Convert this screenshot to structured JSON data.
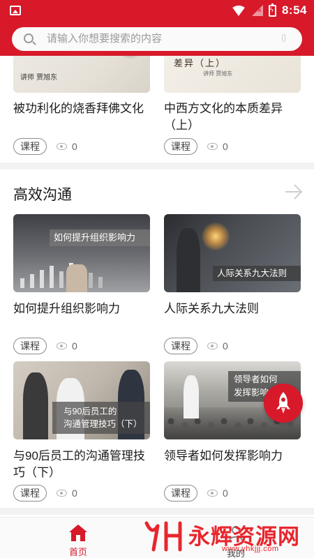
{
  "status_bar": {
    "time": "8:54",
    "icons": [
      "image-icon",
      "wifi-icon",
      "signal-off-icon",
      "battery-charging-icon"
    ]
  },
  "search": {
    "placeholder": "请输入你想要搜索的内容",
    "value": ""
  },
  "colors": {
    "brand_red": "#d7192a",
    "watermark_red": "#e8262d"
  },
  "top_courses": [
    {
      "title": "被功利化的烧香拜佛文化",
      "thumb_text": "讲师 贾旭东",
      "tag": "课程",
      "views": "0"
    },
    {
      "title": "中西方文化的本质差异（上）",
      "thumb_text": "差异（上）",
      "thumb_sub": "讲师 贾旭东",
      "tag": "课程",
      "views": "0"
    }
  ],
  "section": {
    "title": "高效沟通",
    "courses": [
      {
        "title": "如何提升组织影响力",
        "banner": "如何提升组织影响力",
        "tag": "课程",
        "views": "0"
      },
      {
        "title": "人际关系九大法则",
        "banner": "人际关系九大法则",
        "tag": "课程",
        "views": "0"
      },
      {
        "title": "与90后员工的沟通管理技巧（下）",
        "banner_line1": "与90后员工的",
        "banner_line2": "沟通管理技巧（下）",
        "tag": "课程",
        "views": "0"
      },
      {
        "title": "领导者如何发挥影响力",
        "banner_line1": "领导者如何",
        "banner_line2": "发挥影响力",
        "tag": "课程",
        "views": "0"
      }
    ]
  },
  "bottom_nav": {
    "home_label": "首页",
    "mine_label": "我的"
  },
  "watermark": {
    "title": "永辉资源网",
    "url": "www.yhkjjj.com"
  }
}
